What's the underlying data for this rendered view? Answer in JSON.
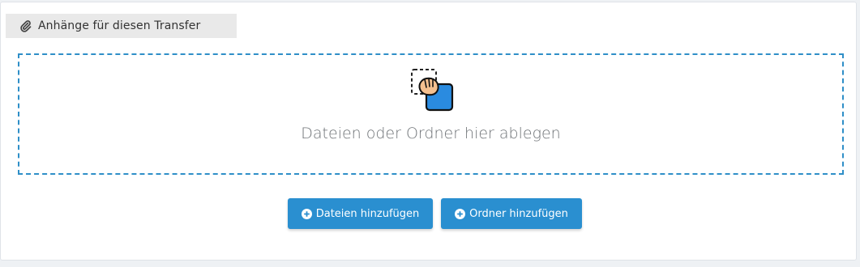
{
  "attachments": {
    "header_title": "Anhänge für diesen Transfer",
    "header_icon": "paperclip-icon"
  },
  "dropzone": {
    "icon": "drag-drop-hand-icon",
    "text": "Dateien oder Ordner hier ablegen",
    "border_color": "#2f8fc8"
  },
  "buttons": {
    "add_files_label": "Dateien hinzufügen",
    "add_folder_label": "Ordner hinzufügen",
    "icon": "plus-circle-icon",
    "color": "#2a8fd0"
  }
}
